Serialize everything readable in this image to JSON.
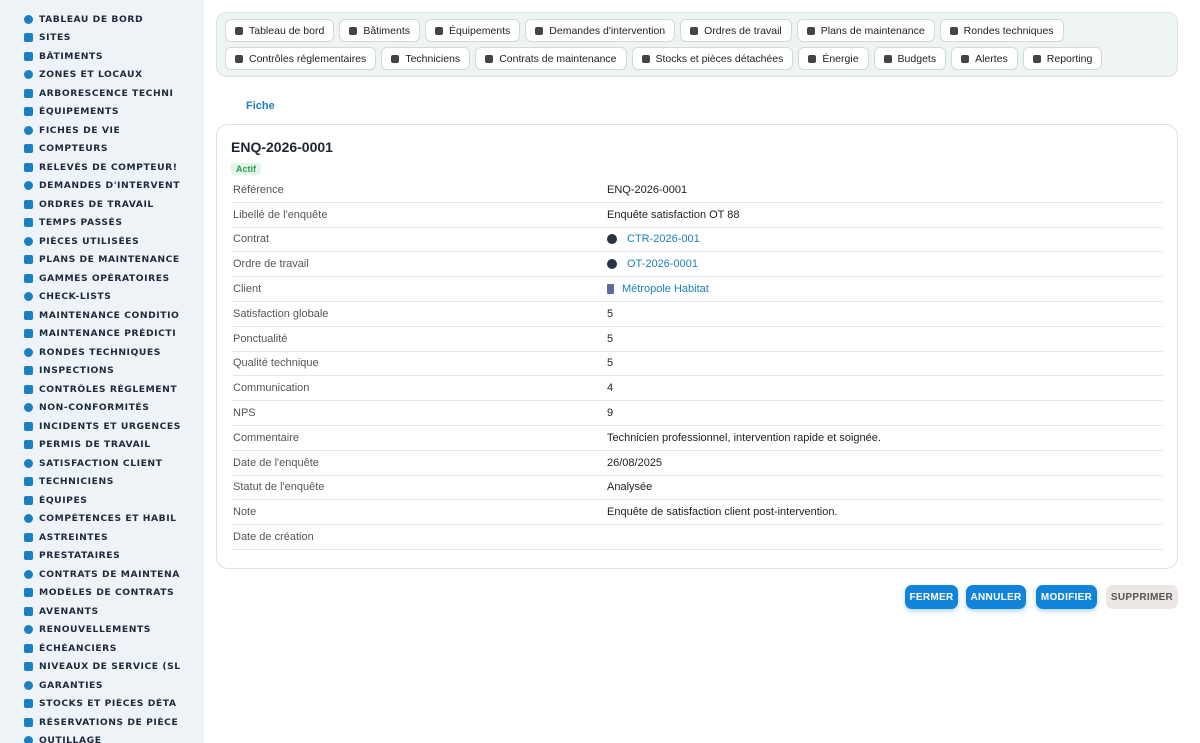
{
  "sidebar": {
    "items": [
      {
        "label": "TABLEAU DE BORD",
        "icon": "dashboard-icon"
      },
      {
        "label": "SITES",
        "icon": "map-pin-icon"
      },
      {
        "label": "BÂTIMENTS",
        "icon": "building-icon"
      },
      {
        "label": "ZONES ET LOCAUX",
        "icon": "zone-icon"
      },
      {
        "label": "ARBORESCENCE TECHNI",
        "icon": "tree-icon"
      },
      {
        "label": "ÉQUIPEMENTS",
        "icon": "gears-icon"
      },
      {
        "label": "FICHES DE VIE",
        "icon": "history-icon"
      },
      {
        "label": "COMPTEURS",
        "icon": "gauge-icon"
      },
      {
        "label": "RELEVÉS DE COMPTEUR!",
        "icon": "reading-icon"
      },
      {
        "label": "DEMANDES D'INTERVENT",
        "icon": "question-icon"
      },
      {
        "label": "ORDRES DE TRAVAIL",
        "icon": "clipboard-icon"
      },
      {
        "label": "TEMPS PASSÉS",
        "icon": "clock-icon"
      },
      {
        "label": "PIÈCES UTILISÉES",
        "icon": "parts-icon"
      },
      {
        "label": "PLANS DE MAINTENANCE",
        "icon": "calendar-icon"
      },
      {
        "label": "GAMMES OPÉRATOIRES",
        "icon": "list-icon"
      },
      {
        "label": "CHECK-LISTS",
        "icon": "checklist-icon"
      },
      {
        "label": "MAINTENANCE CONDITIO",
        "icon": "thermometer-icon"
      },
      {
        "label": "MAINTENANCE PRÉDICTI",
        "icon": "chart-icon"
      },
      {
        "label": "RONDES TECHNIQUES",
        "icon": "route-icon"
      },
      {
        "label": "INSPECTIONS",
        "icon": "search-icon"
      },
      {
        "label": "CONTRÔLES RÉGLEMENT",
        "icon": "clipboard-check-icon"
      },
      {
        "label": "NON-CONFORMITÉS",
        "icon": "alert-circle-icon"
      },
      {
        "label": "INCIDENTS ET URGENCES",
        "icon": "warning-icon"
      },
      {
        "label": "PERMIS DE TRAVAIL",
        "icon": "permit-icon"
      },
      {
        "label": "SATISFACTION CLIENT",
        "icon": "smile-icon"
      },
      {
        "label": "TECHNICIENS",
        "icon": "hardhat-icon"
      },
      {
        "label": "ÉQUIPES",
        "icon": "users-icon"
      },
      {
        "label": "COMPÉTENCES ET HABIL",
        "icon": "badge-icon"
      },
      {
        "label": "ASTREINTES",
        "icon": "phone-icon"
      },
      {
        "label": "PRESTATAIRES",
        "icon": "handshake-icon"
      },
      {
        "label": "CONTRATS DE MAINTENA",
        "icon": "contract-icon"
      },
      {
        "label": "MODÈLES DE CONTRATS",
        "icon": "template-icon"
      },
      {
        "label": "AVENANTS",
        "icon": "amendment-icon"
      },
      {
        "label": "RENOUVELLEMENTS",
        "icon": "refresh-icon"
      },
      {
        "label": "ÉCHÉANCIERS",
        "icon": "schedule-icon"
      },
      {
        "label": "NIVEAUX DE SERVICE (SL",
        "icon": "sla-icon"
      },
      {
        "label": "GARANTIES",
        "icon": "shield-icon"
      },
      {
        "label": "STOCKS ET PIÈCES DÉTA",
        "icon": "boxes-icon"
      },
      {
        "label": "RÉSERVATIONS DE PIÈCE",
        "icon": "bookmark-icon"
      },
      {
        "label": "OUTILLAGE",
        "icon": "tools-icon"
      }
    ]
  },
  "topnav": {
    "row1": [
      {
        "label": "Tableau de bord",
        "icon": "dashboard-icon"
      },
      {
        "label": "Bâtiments",
        "icon": "building-icon"
      },
      {
        "label": "Équipements",
        "icon": "gears-icon"
      },
      {
        "label": "Demandes d'intervention",
        "icon": "question-icon"
      },
      {
        "label": "Ordres de travail",
        "icon": "clipboard-icon"
      },
      {
        "label": "Plans de maintenance",
        "icon": "calendar-icon"
      },
      {
        "label": "Rondes techniques",
        "icon": "route-icon"
      }
    ],
    "row2": [
      {
        "label": "Contrôles réglementaires",
        "icon": "clipboard-check-icon"
      },
      {
        "label": "Techniciens",
        "icon": "hardhat-icon"
      },
      {
        "label": "Contrats de maintenance",
        "icon": "contract-icon"
      },
      {
        "label": "Stocks et pièces détachées",
        "icon": "boxes-icon"
      },
      {
        "label": "Énergie",
        "icon": "bolt-icon"
      },
      {
        "label": "Budgets",
        "icon": "money-icon"
      },
      {
        "label": "Alertes",
        "icon": "bell-icon"
      },
      {
        "label": "Reporting",
        "icon": "pie-chart-icon"
      }
    ]
  },
  "tabs": {
    "active": "Fiche"
  },
  "record": {
    "title": "ENQ-2026-0001",
    "status": "Actif",
    "fields": [
      {
        "label": "Référence",
        "value": "ENQ-2026-0001"
      },
      {
        "label": "Libellé de l'enquête",
        "value": "Enquête satisfaction OT 88"
      },
      {
        "label": "Contrat",
        "value": "CTR-2026-001",
        "link": true,
        "icon": "contract-link-icon"
      },
      {
        "label": "Ordre de travail",
        "value": "OT-2026-0001",
        "link": true,
        "icon": "work-order-link-icon"
      },
      {
        "label": "Client",
        "value": "Métropole Habitat",
        "link": true,
        "icon": "building-icon"
      },
      {
        "label": "Satisfaction globale",
        "value": "5"
      },
      {
        "label": "Ponctualité",
        "value": "5"
      },
      {
        "label": "Qualité technique",
        "value": "5"
      },
      {
        "label": "Communication",
        "value": "4"
      },
      {
        "label": "NPS",
        "value": "9"
      },
      {
        "label": "Commentaire",
        "value": "Technicien professionnel, intervention rapide et soignée."
      },
      {
        "label": "Date de l'enquête",
        "value": "26/08/2025"
      },
      {
        "label": "Statut de l'enquête",
        "value": "Analysée"
      },
      {
        "label": "Note",
        "value": "Enquête de satisfaction client post-intervention."
      },
      {
        "label": "Date de création",
        "value": ""
      }
    ]
  },
  "actions": {
    "close": "FERMER",
    "cancel": "ANNULER",
    "edit": "MODIFIER",
    "delete": "SUPPRIMER"
  }
}
